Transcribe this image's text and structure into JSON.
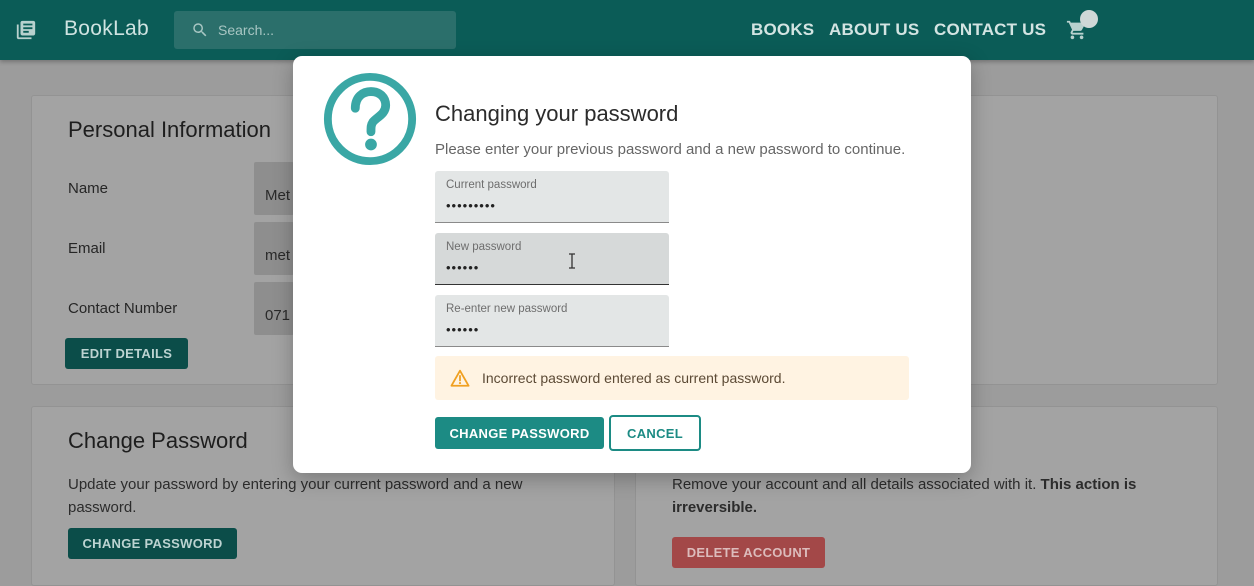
{
  "header": {
    "brand": "BookLab",
    "search_placeholder": "Search...",
    "nav": [
      "BOOKS",
      "ABOUT US",
      "CONTACT US"
    ]
  },
  "personal_info": {
    "title": "Personal Information",
    "fields": [
      {
        "label": "Name",
        "value": "Met"
      },
      {
        "label": "Email",
        "value": "met"
      },
      {
        "label": "Contact Number",
        "value": "071"
      }
    ],
    "edit_button": "EDIT DETAILS"
  },
  "change_password_card": {
    "title": "Change Password",
    "description": "Update your password by entering your current password and a new password.",
    "button": "CHANGE PASSWORD"
  },
  "delete_card": {
    "description_plain": "Remove your account and all details associated with it.",
    "description_bold": "This action is irreversible.",
    "button": "DELETE ACCOUNT"
  },
  "modal": {
    "title": "Changing your password",
    "subtitle": "Please enter your previous password and a new password to continue.",
    "fields": [
      {
        "label": "Current password",
        "value": "•••••••••"
      },
      {
        "label": "New password",
        "value": "••••••"
      },
      {
        "label": "Re-enter new password",
        "value": "••••••"
      }
    ],
    "alert": "Incorrect password entered as current password.",
    "confirm_button": "CHANGE PASSWORD",
    "cancel_button": "CANCEL"
  },
  "colors": {
    "header": "#0b5c57",
    "accent": "#1c8b84",
    "warning_bg": "#fff3e2",
    "warning_icon": "#f0a021",
    "danger": "#a34848"
  }
}
